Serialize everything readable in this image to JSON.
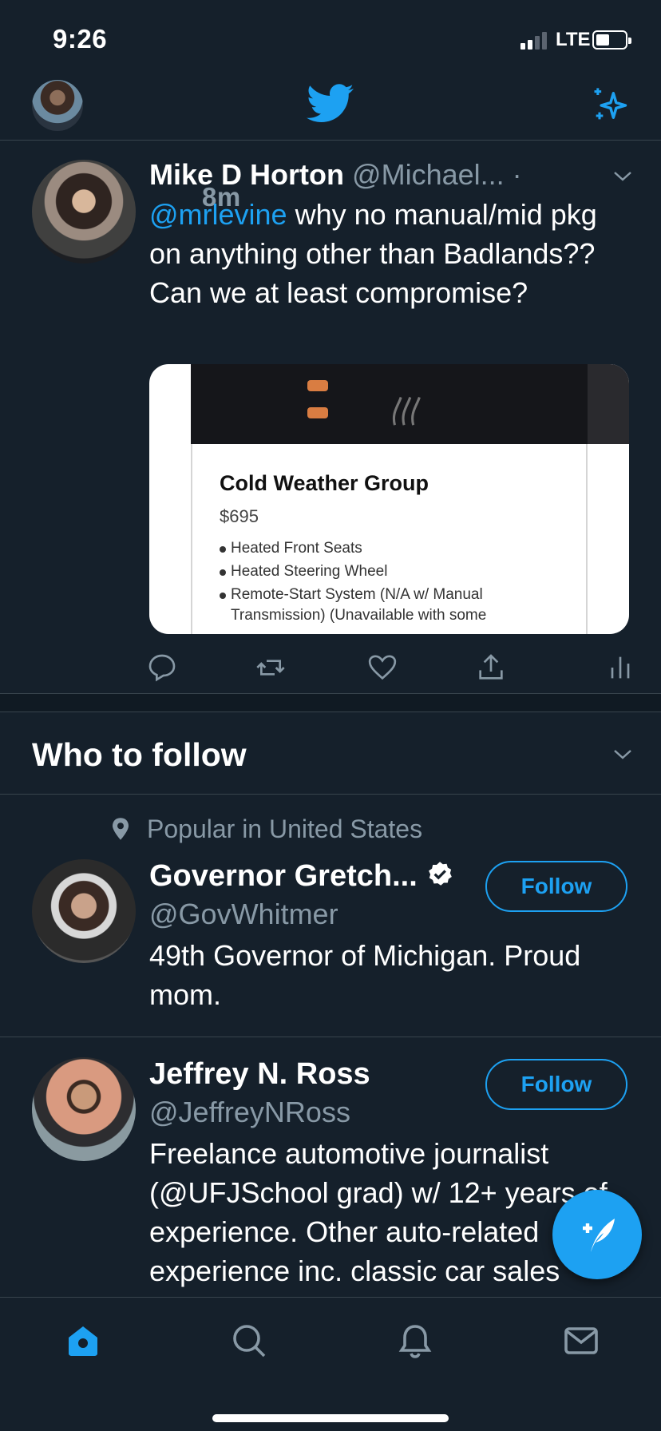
{
  "status_bar": {
    "time": "9:26",
    "network": "LTE"
  },
  "tweet": {
    "name": "Mike D Horton",
    "handle": "@Michael...",
    "separator": "·",
    "time": "8m",
    "mention": "@mrlevine",
    "text": " why no manual/mid pkg on anything other than Badlands?? Can we at least compromise?",
    "media": {
      "title": "Cold Weather Group",
      "price": "$695",
      "items": [
        "Heated Front Seats",
        "Heated Steering Wheel",
        "Remote-Start System (N/A w/ Manual Transmission) (Unavailable with some"
      ]
    }
  },
  "who_to_follow": {
    "title": "Who to follow",
    "context": "Popular in United States",
    "users": [
      {
        "name": "Governor Gretch...",
        "handle": "@GovWhitmer",
        "bio": "49th Governor of Michigan. Proud mom.",
        "follow_label": "Follow"
      },
      {
        "name": "Jeffrey N. Ross",
        "handle": "@JeffreyNRoss",
        "bio": "Freelance automotive journalist (@UFJSchool grad) w/ 12+ years of experience. Other auto-related experience inc. classic car sales",
        "follow_label": "Follow"
      }
    ]
  },
  "colors": {
    "accent": "#1da1f2",
    "background": "#15202b",
    "secondary_text": "#8899a6"
  },
  "icons": {
    "top_bar": [
      "twitter-bird-icon",
      "sparkle-icon"
    ],
    "actions": [
      "reply-icon",
      "retweet-icon",
      "like-icon",
      "share-icon",
      "analytics-icon"
    ],
    "tabs": [
      "home-icon",
      "search-icon",
      "notifications-icon",
      "messages-icon"
    ],
    "fab": "compose-tweet-icon"
  }
}
